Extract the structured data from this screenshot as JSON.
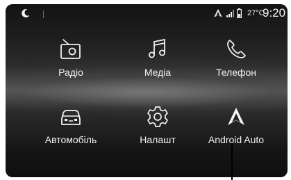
{
  "status_bar": {
    "icons": [
      "moon-icon",
      "android-auto-icon",
      "signal-icon",
      "battery-icon"
    ],
    "temperature": "27°C",
    "time": "9:20"
  },
  "apps": {
    "radio": {
      "label": "Радіо",
      "icon": "radio-icon"
    },
    "media": {
      "label": "Медіа",
      "icon": "music-note-icon"
    },
    "phone": {
      "label": "Телефон",
      "icon": "phone-icon"
    },
    "vehicle": {
      "label": "Автомобіль",
      "icon": "car-icon"
    },
    "settings": {
      "label": "Налашт",
      "icon": "gear-icon"
    },
    "android_auto": {
      "label": "Android Auto",
      "icon": "android-auto-icon"
    }
  },
  "colors": {
    "background_dark": "#141414",
    "highlight_band": "#575757",
    "text": "#f2f2f2"
  }
}
